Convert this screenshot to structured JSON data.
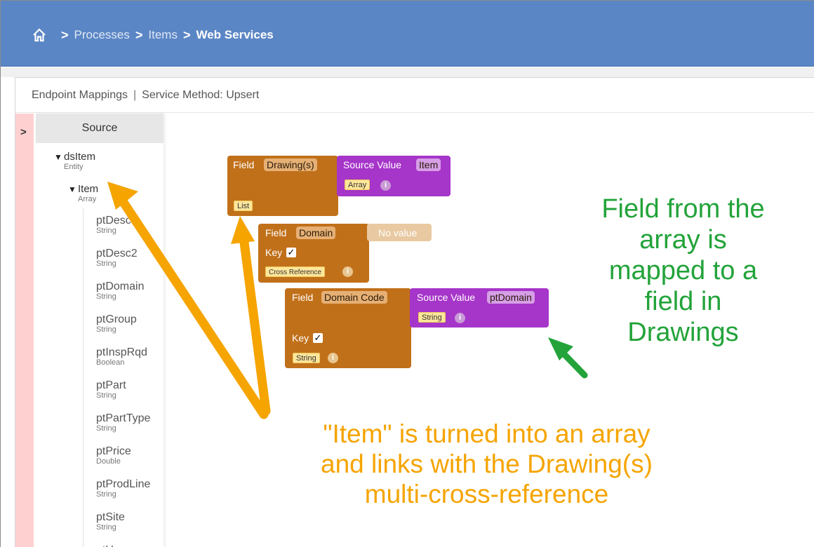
{
  "breadcrumb": {
    "home_icon": "home-icon",
    "items": [
      "Processes",
      "Items",
      "Web Services"
    ]
  },
  "panel": {
    "title": "Endpoint Mappings",
    "subtitle": "Service Method: Upsert"
  },
  "source": {
    "title": "Source",
    "root": {
      "name": "dsItem",
      "type": "Entity"
    },
    "child": {
      "name": "Item",
      "type": "Array"
    },
    "fields": [
      {
        "name": "ptDesc1",
        "type": "String"
      },
      {
        "name": "ptDesc2",
        "type": "String"
      },
      {
        "name": "ptDomain",
        "type": "String"
      },
      {
        "name": "ptGroup",
        "type": "String"
      },
      {
        "name": "ptInspRqd",
        "type": "Boolean"
      },
      {
        "name": "ptPart",
        "type": "String"
      },
      {
        "name": "ptPartType",
        "type": "String"
      },
      {
        "name": "ptPrice",
        "type": "Double"
      },
      {
        "name": "ptProdLine",
        "type": "String"
      },
      {
        "name": "ptSite",
        "type": "String"
      },
      {
        "name": "ptUm",
        "type": ""
      }
    ]
  },
  "blocks": {
    "drawing": {
      "label": "Field",
      "field": "Drawing(s)",
      "tag": "List"
    },
    "source_item": {
      "label": "Source Value",
      "value": "Item",
      "tag": "Array"
    },
    "domain": {
      "label": "Field",
      "field": "Domain",
      "key_label": "Key",
      "tag": "Cross Reference"
    },
    "no_value": {
      "label": "No value"
    },
    "domain_code": {
      "label": "Field",
      "field": "Domain Code",
      "key_label": "Key",
      "tag": "String"
    },
    "source_domain": {
      "label": "Source Value",
      "value": "ptDomain",
      "tag": "String"
    }
  },
  "annotations": {
    "green": [
      "Field from the",
      "array is",
      "mapped to a",
      "field in",
      "Drawings"
    ],
    "orange": [
      "\"Item\" is turned into an array",
      "and links with the Drawing(s)",
      "multi-cross-reference"
    ]
  },
  "colors": {
    "header": "#5b86c5",
    "field_block": "#c1701a",
    "source_block": "#a635c9",
    "green_text": "#23a33a",
    "orange_text": "#f5a400"
  }
}
